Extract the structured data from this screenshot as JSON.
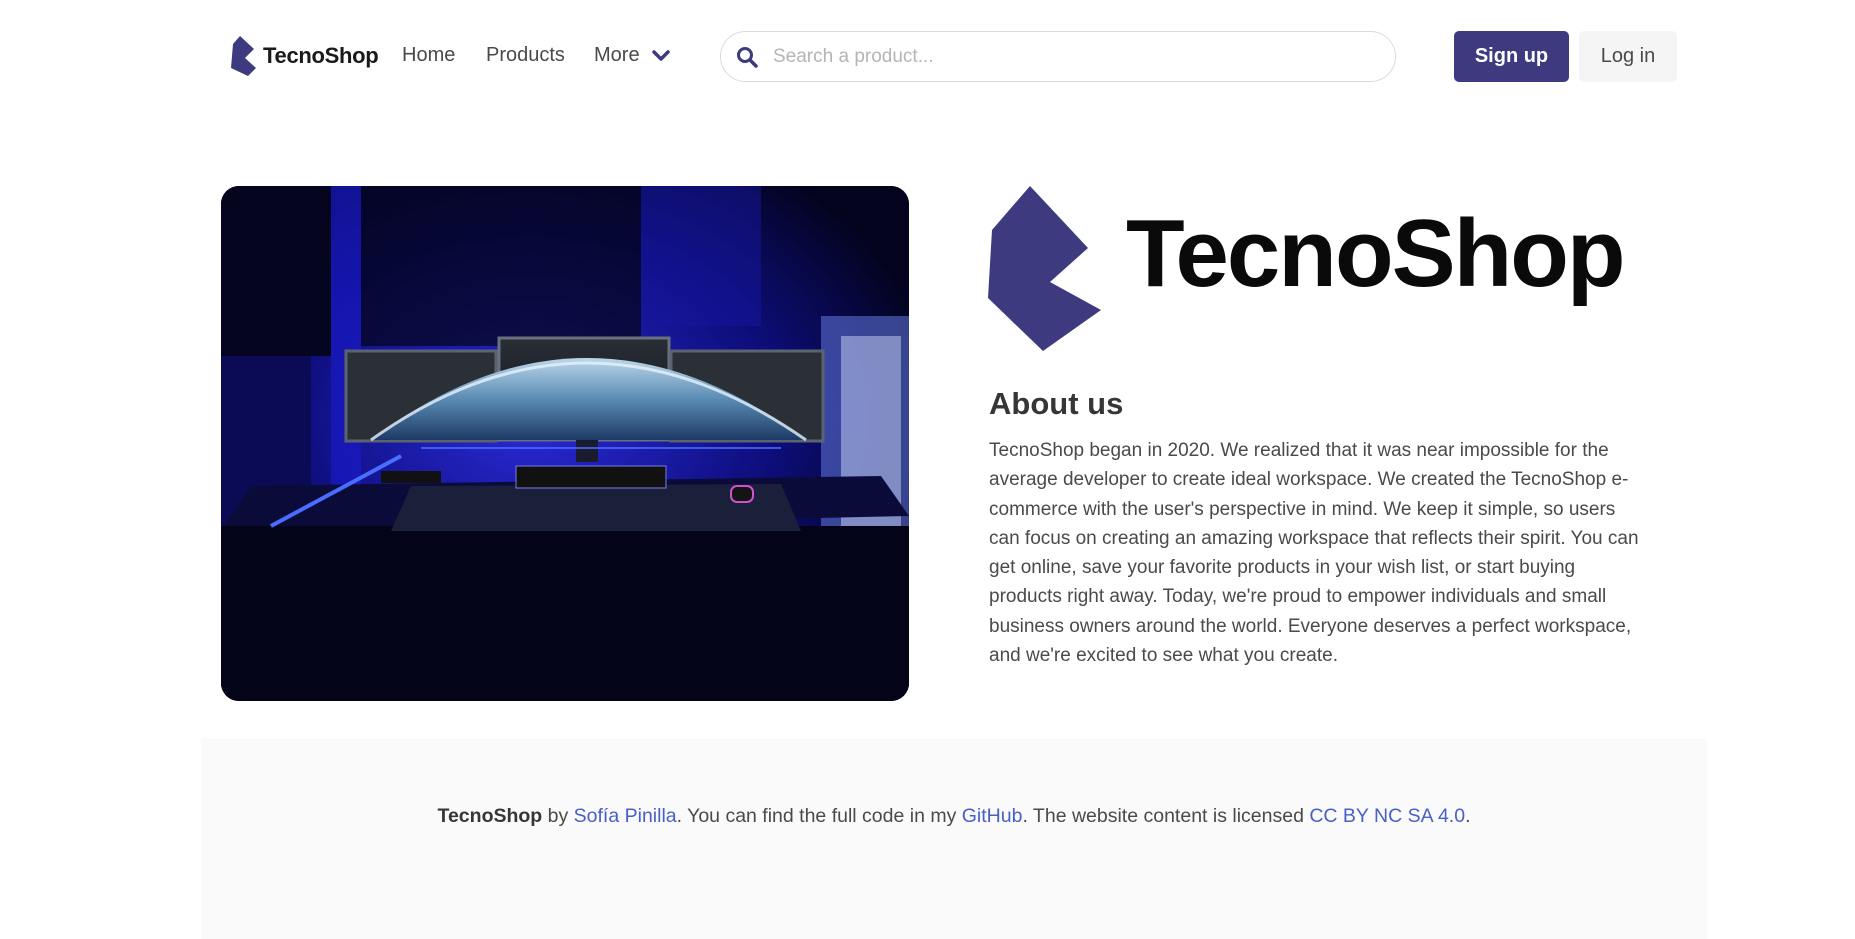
{
  "nav": {
    "brand": "TecnoShop",
    "home": "Home",
    "products": "Products",
    "more": "More",
    "search_placeholder": "Search a product...",
    "signup": "Sign up",
    "login": "Log in"
  },
  "hero": {
    "logo_text": "TecnoShop",
    "about_title": "About us",
    "about_text": "TecnoShop began in 2020. We realized that it was near impossible for the average developer to create ideal workspace. We created the TecnoShop e-commerce with the user's perspective in mind. We keep it simple, so users can focus on creating an amazing workspace that reflects their spirit. You can get online, save your favorite products in your wish list, or start buying products right away. Today, we're proud to empower individuals and small business owners around the world. Everyone deserves a perfect workspace, and we're excited to see what you create."
  },
  "footer": {
    "brand": "TecnoShop",
    "by": " by ",
    "author": "Sofía Pinilla",
    "mid": ". You can find the full code in my ",
    "github": "GitHub",
    "license_pre": ". The website content is licensed ",
    "license": "CC BY NC SA 4.0",
    "end": "."
  },
  "colors": {
    "brand": "#3e3a80",
    "link": "#485fc7",
    "footer_bg": "#fafafa"
  },
  "icons": {
    "brand": "tecnoshop-logo-icon",
    "dropdown": "chevron-down-icon",
    "search": "search-icon"
  }
}
